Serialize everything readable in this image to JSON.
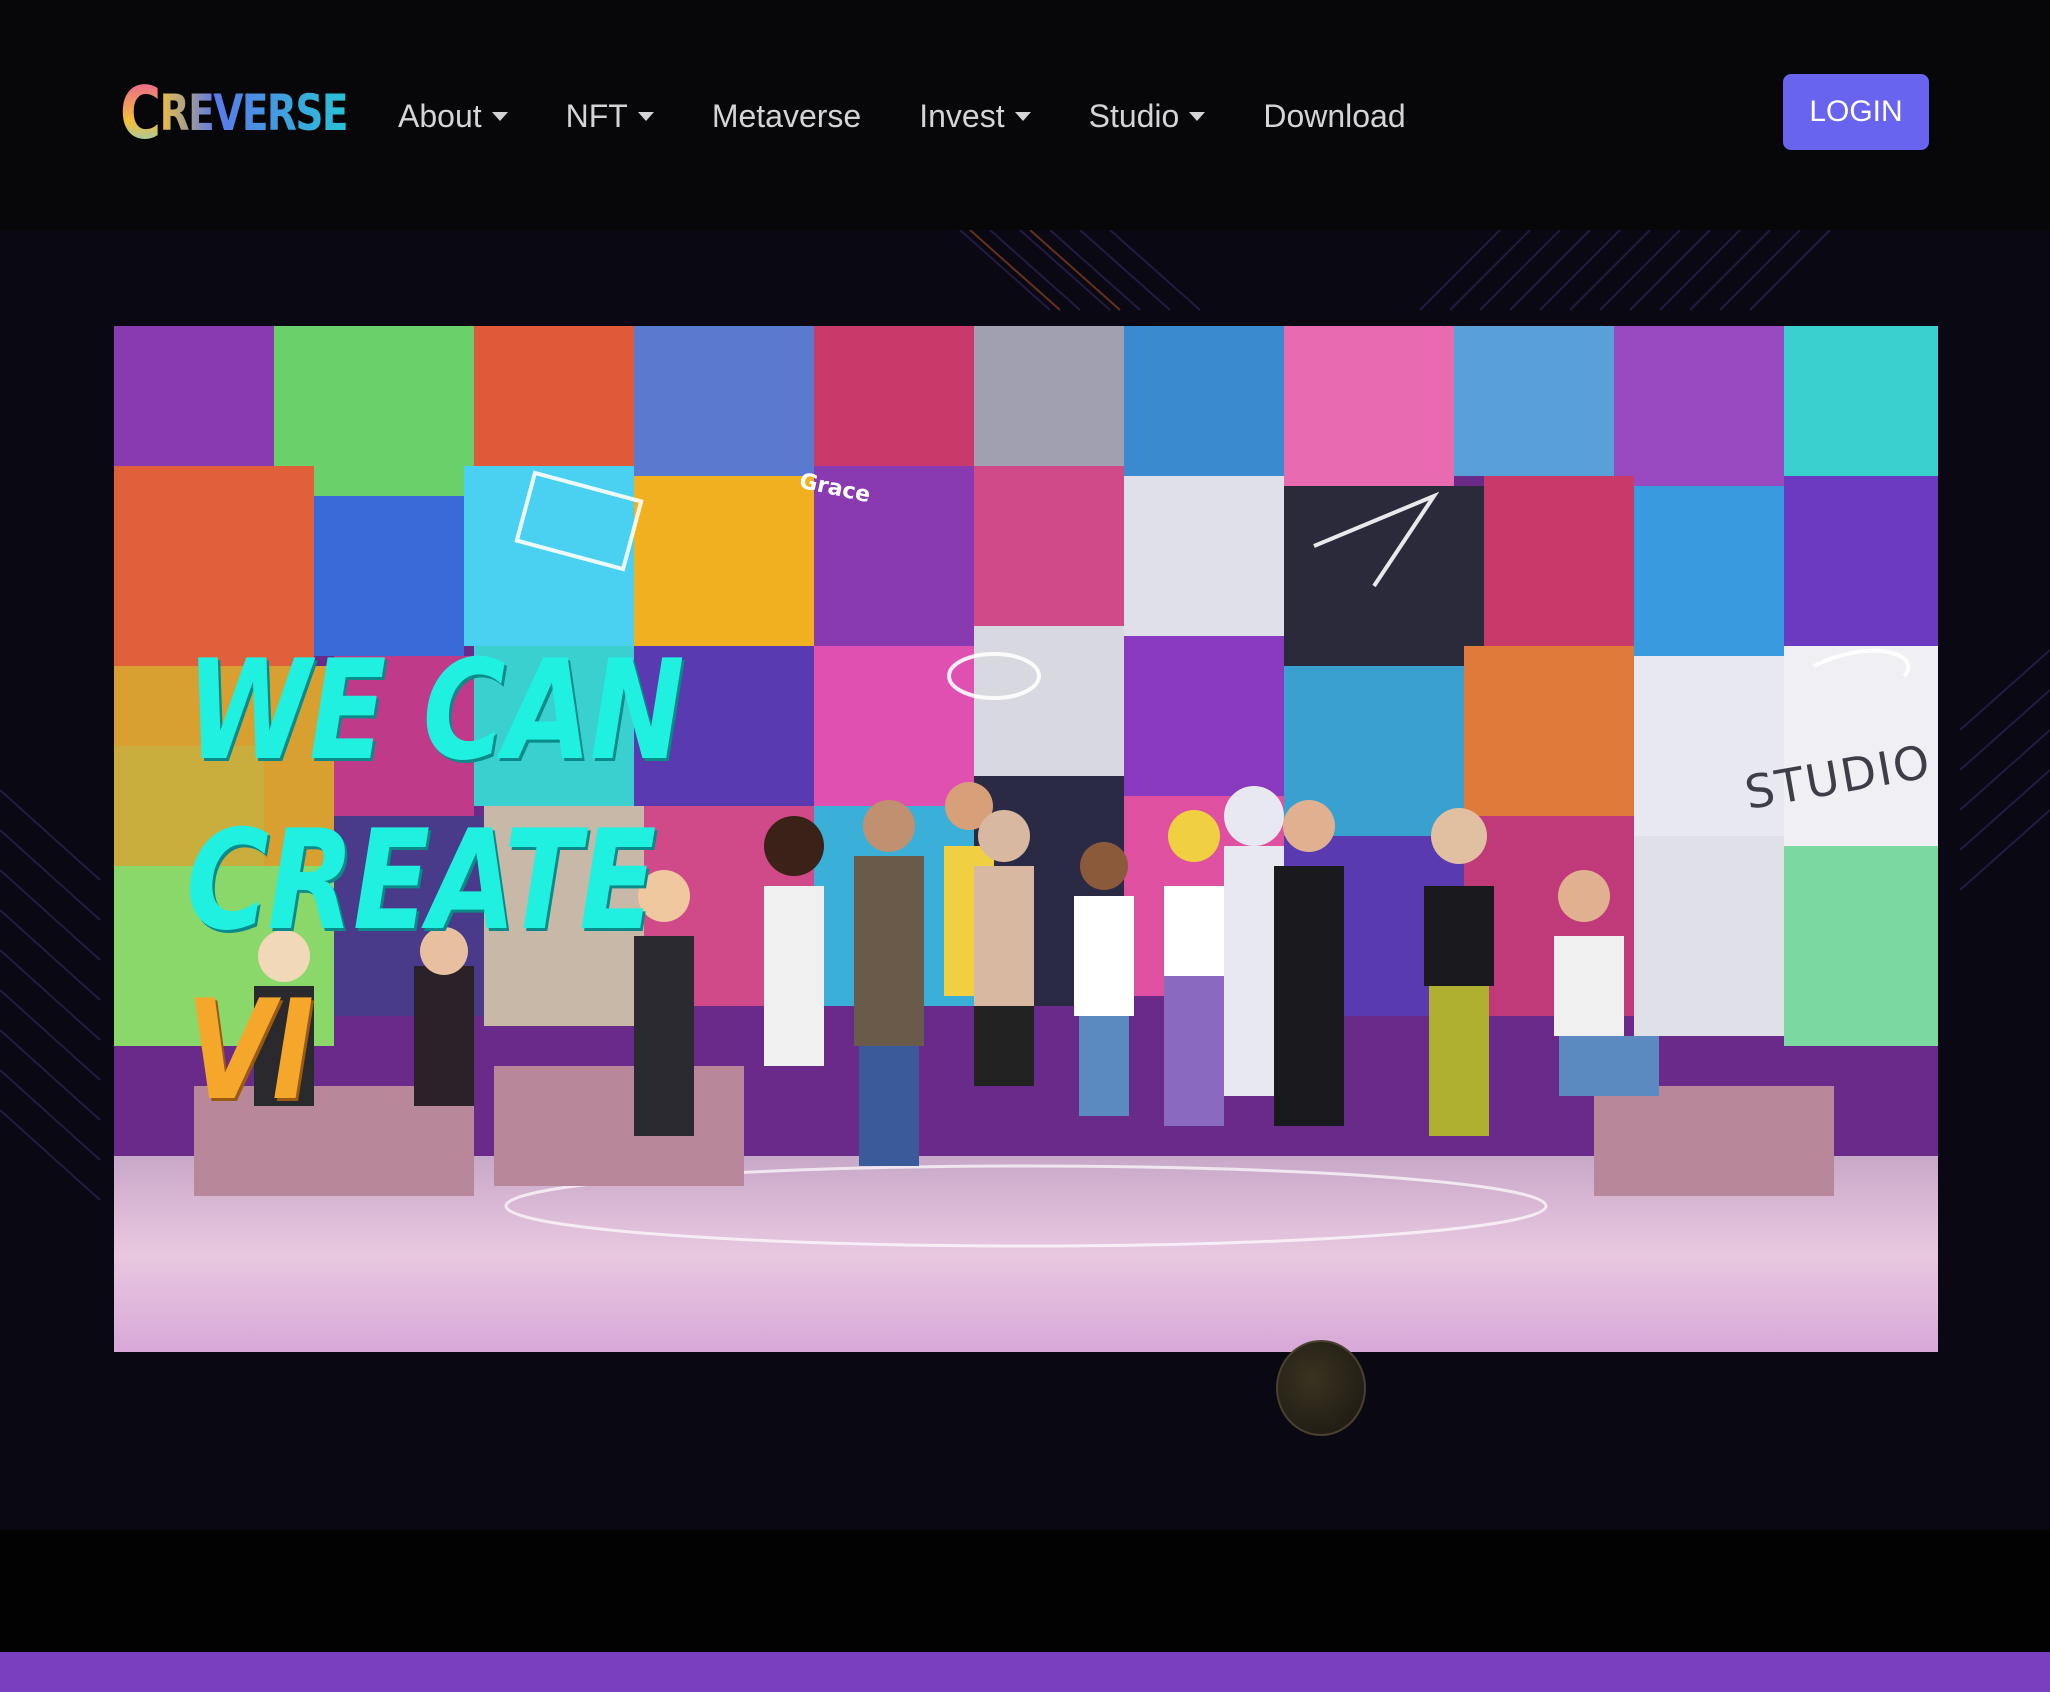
{
  "brand": {
    "logo_first_letter": "C",
    "logo_rest": "REVERSE",
    "colors": {
      "letter_c_gradient": [
        "#e84fa6",
        "#f5c03a"
      ],
      "rest_gradient": [
        "#5a7ae8",
        "#28c2d6"
      ]
    }
  },
  "nav": {
    "items": [
      {
        "label": "About",
        "dropdown": true
      },
      {
        "label": "NFT",
        "dropdown": true
      },
      {
        "label": "Metaverse",
        "dropdown": false
      },
      {
        "label": "Invest",
        "dropdown": true
      },
      {
        "label": "Studio",
        "dropdown": true
      },
      {
        "label": "Download",
        "dropdown": false
      }
    ],
    "login_label": "LOGIN"
  },
  "hero": {
    "video_text_lines": [
      "WE CAN",
      "CREATE",
      "VI"
    ],
    "sign_studio": "STUDIO",
    "sign_grace": "Grace"
  },
  "colors": {
    "background": "#050507",
    "hero_background": "#0a0812",
    "login_button": "#6964f0",
    "title_cyan": "#1ff0e0",
    "title_orange": "#f5a72c",
    "bottom_bar": "#7a3fbf"
  }
}
